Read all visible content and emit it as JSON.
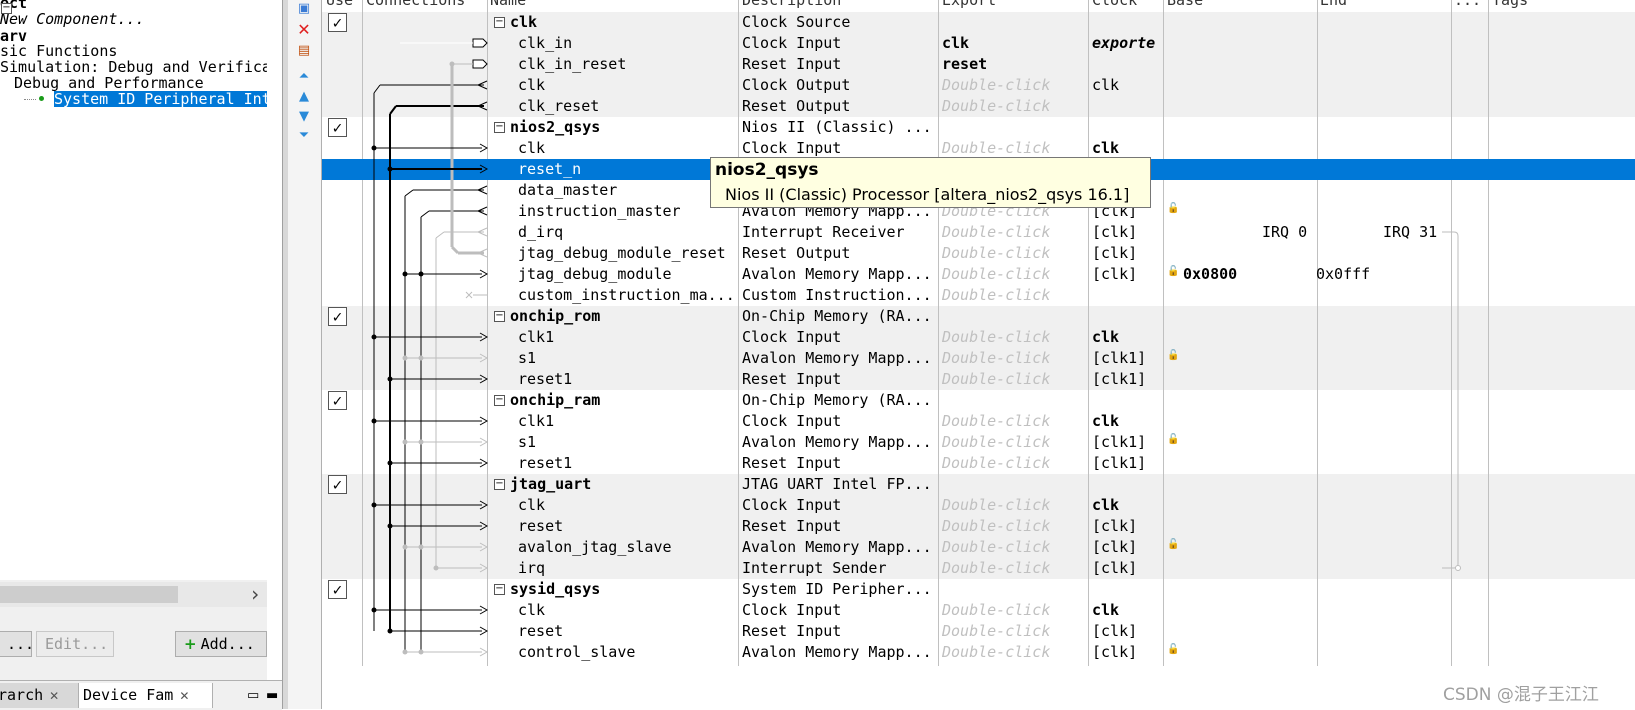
{
  "library": {
    "tree": [
      {
        "text": "ect",
        "style": "bold",
        "indent": 0
      },
      {
        "text": "New Component...",
        "style": "italic",
        "indent": 0
      },
      {
        "text": "arv",
        "style": "bold",
        "indent": 0
      },
      {
        "text": "sic Functions",
        "style": "normal",
        "indent": 0
      },
      {
        "text": "Simulation: Debug and Verifica",
        "style": "normal",
        "indent": 0
      },
      {
        "text": "Debug and Performance",
        "style": "normal",
        "indent": 1
      },
      {
        "text": "System ID Peripheral Int",
        "style": "selected",
        "indent": 2
      }
    ],
    "buttons": {
      "more": "...",
      "edit": "Edit...",
      "add": "Add..."
    },
    "bottom_tabs": {
      "hierarchy": "rarch",
      "device_family": "Device Fam"
    }
  },
  "toolbar_icons": [
    "system-contents-icon",
    "remove-icon",
    "edit-icon",
    "move-top-icon",
    "move-up-icon",
    "move-down-icon",
    "move-bottom-icon"
  ],
  "table": {
    "headers": [
      "Use",
      "Connections",
      "Name",
      "Description",
      "Export",
      "Clock",
      "Base",
      "End",
      "...",
      "Tags"
    ],
    "rows": [
      {
        "kind": "component",
        "use": true,
        "name": "clk",
        "desc": "Clock Source",
        "export": "",
        "export_style": "",
        "clock": "",
        "clock_style": "",
        "base": "",
        "end": "",
        "irq": ""
      },
      {
        "kind": "port",
        "name": "clk_in",
        "desc": "Clock Input",
        "export": "clk",
        "export_style": "bold",
        "clock": "exporte",
        "clock_style": "bolditalic",
        "base": "",
        "end": "",
        "irq": ""
      },
      {
        "kind": "port",
        "name": "clk_in_reset",
        "desc": "Reset Input",
        "export": "reset",
        "export_style": "bold",
        "clock": "",
        "clock_style": "",
        "base": "",
        "end": "",
        "irq": ""
      },
      {
        "kind": "port",
        "name": "clk",
        "desc": "Clock Output",
        "export": "Double-click",
        "export_style": "ghost",
        "clock": "clk",
        "clock_style": "",
        "base": "",
        "end": "",
        "irq": ""
      },
      {
        "kind": "port",
        "name": "clk_reset",
        "desc": "Reset Output",
        "export": "Double-click",
        "export_style": "ghost",
        "clock": "",
        "clock_style": "",
        "base": "",
        "end": "",
        "irq": ""
      },
      {
        "kind": "component",
        "use": true,
        "name": "nios2_qsys",
        "desc": "Nios II (Classic) ...",
        "export": "",
        "export_style": "",
        "clock": "",
        "clock_style": "",
        "base": "",
        "end": "",
        "irq": ""
      },
      {
        "kind": "port",
        "name": "clk",
        "desc": "Clock Input",
        "export": "Double-click",
        "export_style": "ghost",
        "clock": "clk",
        "clock_style": "bold",
        "base": "",
        "end": "",
        "irq": ""
      },
      {
        "kind": "port",
        "name": "reset_n",
        "desc": "",
        "export": "",
        "export_style": "",
        "clock": "",
        "clock_style": "",
        "base": "",
        "end": "",
        "irq": "",
        "selected": true
      },
      {
        "kind": "port",
        "name": "data_master",
        "desc": "",
        "export": "",
        "export_style": "",
        "clock": "",
        "clock_style": "",
        "base": "",
        "end": "",
        "irq": ""
      },
      {
        "kind": "port",
        "name": "instruction_master",
        "desc": "Avalon Memory Mapp...",
        "export": "Double-click",
        "export_style": "ghost",
        "clock": "[clk]",
        "clock_style": "",
        "base": "",
        "end": "",
        "irq": ""
      },
      {
        "kind": "port",
        "name": "d_irq",
        "desc": "Interrupt Receiver",
        "export": "Double-click",
        "export_style": "ghost",
        "clock": "[clk]",
        "clock_style": "",
        "base": "IRQ 0",
        "end": "IRQ 31",
        "irq": ""
      },
      {
        "kind": "port",
        "name": "jtag_debug_module_reset",
        "desc": "Reset Output",
        "export": "Double-click",
        "export_style": "ghost",
        "clock": "[clk]",
        "clock_style": "",
        "base": "",
        "end": "",
        "irq": ""
      },
      {
        "kind": "port",
        "name": "jtag_debug_module",
        "desc": "Avalon Memory Mapp...",
        "export": "Double-click",
        "export_style": "ghost",
        "clock": "[clk]",
        "clock_style": "",
        "base": "0x0800",
        "end": "0x0fff",
        "irq": ""
      },
      {
        "kind": "port",
        "name": "custom_instruction_ma...",
        "desc": "Custom Instruction...",
        "export": "Double-click",
        "export_style": "ghost",
        "clock": "",
        "clock_style": "",
        "base": "",
        "end": "",
        "irq": ""
      },
      {
        "kind": "component",
        "use": true,
        "name": "onchip_rom",
        "desc": "On-Chip Memory (RA...",
        "export": "",
        "export_style": "",
        "clock": "",
        "clock_style": "",
        "base": "",
        "end": "",
        "irq": ""
      },
      {
        "kind": "port",
        "name": "clk1",
        "desc": "Clock Input",
        "export": "Double-click",
        "export_style": "ghost",
        "clock": "clk",
        "clock_style": "bold",
        "base": "",
        "end": "",
        "irq": ""
      },
      {
        "kind": "port",
        "name": "s1",
        "desc": "Avalon Memory Mapp...",
        "export": "Double-click",
        "export_style": "ghost",
        "clock": "[clk1]",
        "clock_style": "",
        "base": "",
        "end": "",
        "irq": ""
      },
      {
        "kind": "port",
        "name": "reset1",
        "desc": "Reset Input",
        "export": "Double-click",
        "export_style": "ghost",
        "clock": "[clk1]",
        "clock_style": "",
        "base": "",
        "end": "",
        "irq": ""
      },
      {
        "kind": "component",
        "use": true,
        "name": "onchip_ram",
        "desc": "On-Chip Memory (RA...",
        "export": "",
        "export_style": "",
        "clock": "",
        "clock_style": "",
        "base": "",
        "end": "",
        "irq": ""
      },
      {
        "kind": "port",
        "name": "clk1",
        "desc": "Clock Input",
        "export": "Double-click",
        "export_style": "ghost",
        "clock": "clk",
        "clock_style": "bold",
        "base": "",
        "end": "",
        "irq": ""
      },
      {
        "kind": "port",
        "name": "s1",
        "desc": "Avalon Memory Mapp...",
        "export": "Double-click",
        "export_style": "ghost",
        "clock": "[clk1]",
        "clock_style": "",
        "base": "",
        "end": "",
        "irq": ""
      },
      {
        "kind": "port",
        "name": "reset1",
        "desc": "Reset Input",
        "export": "Double-click",
        "export_style": "ghost",
        "clock": "[clk1]",
        "clock_style": "",
        "base": "",
        "end": "",
        "irq": ""
      },
      {
        "kind": "component",
        "use": true,
        "name": "jtag_uart",
        "desc": "JTAG UART Intel FP...",
        "export": "",
        "export_style": "",
        "clock": "",
        "clock_style": "",
        "base": "",
        "end": "",
        "irq": ""
      },
      {
        "kind": "port",
        "name": "clk",
        "desc": "Clock Input",
        "export": "Double-click",
        "export_style": "ghost",
        "clock": "clk",
        "clock_style": "bold",
        "base": "",
        "end": "",
        "irq": ""
      },
      {
        "kind": "port",
        "name": "reset",
        "desc": "Reset Input",
        "export": "Double-click",
        "export_style": "ghost",
        "clock": "[clk]",
        "clock_style": "",
        "base": "",
        "end": "",
        "irq": ""
      },
      {
        "kind": "port",
        "name": "avalon_jtag_slave",
        "desc": "Avalon Memory Mapp...",
        "export": "Double-click",
        "export_style": "ghost",
        "clock": "[clk]",
        "clock_style": "",
        "base": "",
        "end": "",
        "irq": ""
      },
      {
        "kind": "port",
        "name": "irq",
        "desc": "Interrupt Sender",
        "export": "Double-click",
        "export_style": "ghost",
        "clock": "[clk]",
        "clock_style": "",
        "base": "",
        "end": "",
        "irq": ""
      },
      {
        "kind": "component",
        "use": true,
        "name": "sysid_qsys",
        "desc": "System ID Peripher...",
        "export": "",
        "export_style": "",
        "clock": "",
        "clock_style": "",
        "base": "",
        "end": "",
        "irq": ""
      },
      {
        "kind": "port",
        "name": "clk",
        "desc": "Clock Input",
        "export": "Double-click",
        "export_style": "ghost",
        "clock": "clk",
        "clock_style": "bold",
        "base": "",
        "end": "",
        "irq": ""
      },
      {
        "kind": "port",
        "name": "reset",
        "desc": "Reset Input",
        "export": "Double-click",
        "export_style": "ghost",
        "clock": "[clk]",
        "clock_style": "",
        "base": "",
        "end": "",
        "irq": ""
      },
      {
        "kind": "port",
        "name": "control_slave",
        "desc": "Avalon Memory Mapp...",
        "export": "Double-click",
        "export_style": "ghost",
        "clock": "[clk]",
        "clock_style": "",
        "base": "",
        "end": "",
        "irq": ""
      }
    ]
  },
  "tooltip": {
    "title": "nios2_qsys",
    "text": "Nios II (Classic) Processor [altera_nios2_qsys 16.1]"
  },
  "watermark": "CSDN @混子王江江",
  "colors": {
    "selection": "#0078d7",
    "band": "#f0f0f0",
    "ghost": "#c0c0c0",
    "tooltip_bg": "#ffffe1"
  }
}
